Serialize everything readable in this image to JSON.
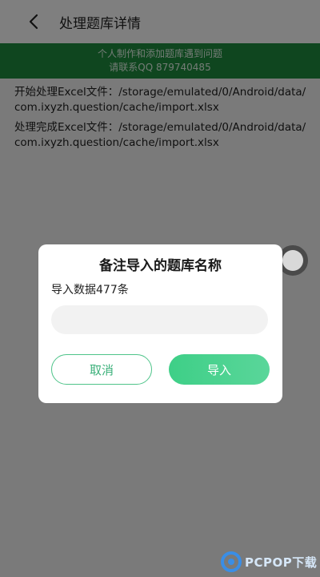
{
  "header": {
    "back_icon": "chevron-left-icon",
    "title": "处理题库详情"
  },
  "banner": {
    "line1": "个人制作和添加题库遇到问题",
    "line2": "请联系QQ 879740485"
  },
  "log": [
    "开始处理Excel文件：/storage/emulated/0/Android/data/com.ixyzh.question/cache/import.xlsx",
    "处理完成Excel文件：/storage/emulated/0/Android/data/com.ixyzh.question/cache/import.xlsx"
  ],
  "dialog": {
    "title": "备注导入的题库名称",
    "message": "导入数据477条",
    "input_value": "",
    "input_placeholder": "",
    "cancel_label": "取消",
    "import_label": "导入"
  },
  "watermark": {
    "text": "PCPOP下载"
  },
  "colors": {
    "banner": "#1f8c3f",
    "accent": "#3ecf87"
  }
}
